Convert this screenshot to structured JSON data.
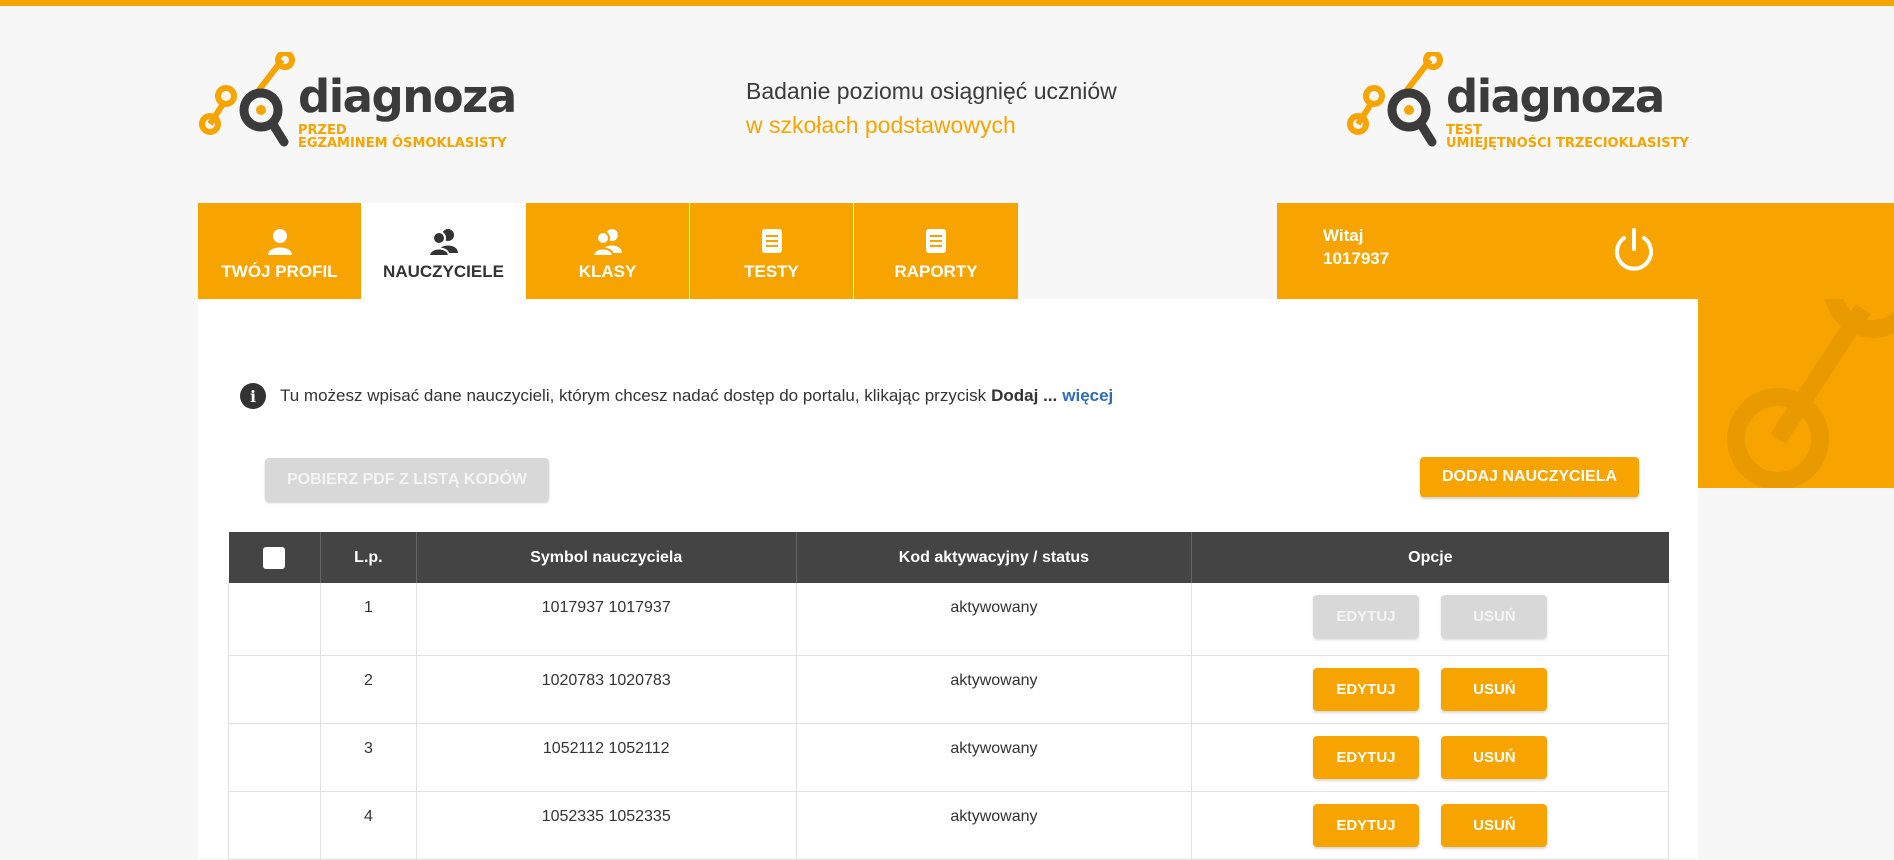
{
  "header": {
    "logo_left": {
      "word": "diagnoza",
      "sub_line1": "PRZED",
      "sub_line2": "EGZAMINEM ÓSMOKLASISTY"
    },
    "logo_right": {
      "word": "diagnoza",
      "sub_line1": "TEST",
      "sub_line2": "UMIEJĘTNOŚCI TRZECIOKLASISTY"
    },
    "tagline_line1": "Badanie poziomu osiągnięć uczniów",
    "tagline_line2": "w szkołach podstawowych"
  },
  "nav": {
    "tabs": [
      {
        "label": "TWÓJ PROFIL",
        "icon": "user-icon"
      },
      {
        "label": "NAUCZYCIELE",
        "icon": "users-icon",
        "active": true
      },
      {
        "label": "KLASY",
        "icon": "users-icon"
      },
      {
        "label": "TESTY",
        "icon": "document-icon"
      },
      {
        "label": "RAPORTY",
        "icon": "document-icon"
      }
    ]
  },
  "welcome": {
    "greeting": "Witaj",
    "user_id": "1017937",
    "icon": "power-icon"
  },
  "info": {
    "text": "Tu możesz wpisać dane nauczycieli, którym chcesz nadać dostęp do portalu, klikając przycisk",
    "bold": "Dodaj ...",
    "link": "więcej"
  },
  "actions": {
    "download_pdf": "POBIERZ PDF Z LISTĄ KODÓW",
    "add_teacher": "DODAJ NAUCZYCIELA"
  },
  "table": {
    "headers": [
      "",
      "L.p.",
      "Symbol nauczyciela",
      "Kod aktywacyjny / status",
      "Opcje"
    ],
    "edit_label": "EDYTUJ",
    "delete_label": "USUŃ",
    "rows": [
      {
        "lp": "1",
        "symbol": "1017937 1017937",
        "status": "aktywowany",
        "buttons_enabled": false
      },
      {
        "lp": "2",
        "symbol": "1020783 1020783",
        "status": "aktywowany",
        "buttons_enabled": true
      },
      {
        "lp": "3",
        "symbol": "1052112 1052112",
        "status": "aktywowany",
        "buttons_enabled": true
      },
      {
        "lp": "4",
        "symbol": "1052335 1052335",
        "status": "aktywowany",
        "buttons_enabled": true
      }
    ]
  },
  "colors": {
    "accent": "#f7a400",
    "dark": "#444444",
    "link": "#2d6db5",
    "disabled": "#d8d8d8"
  }
}
